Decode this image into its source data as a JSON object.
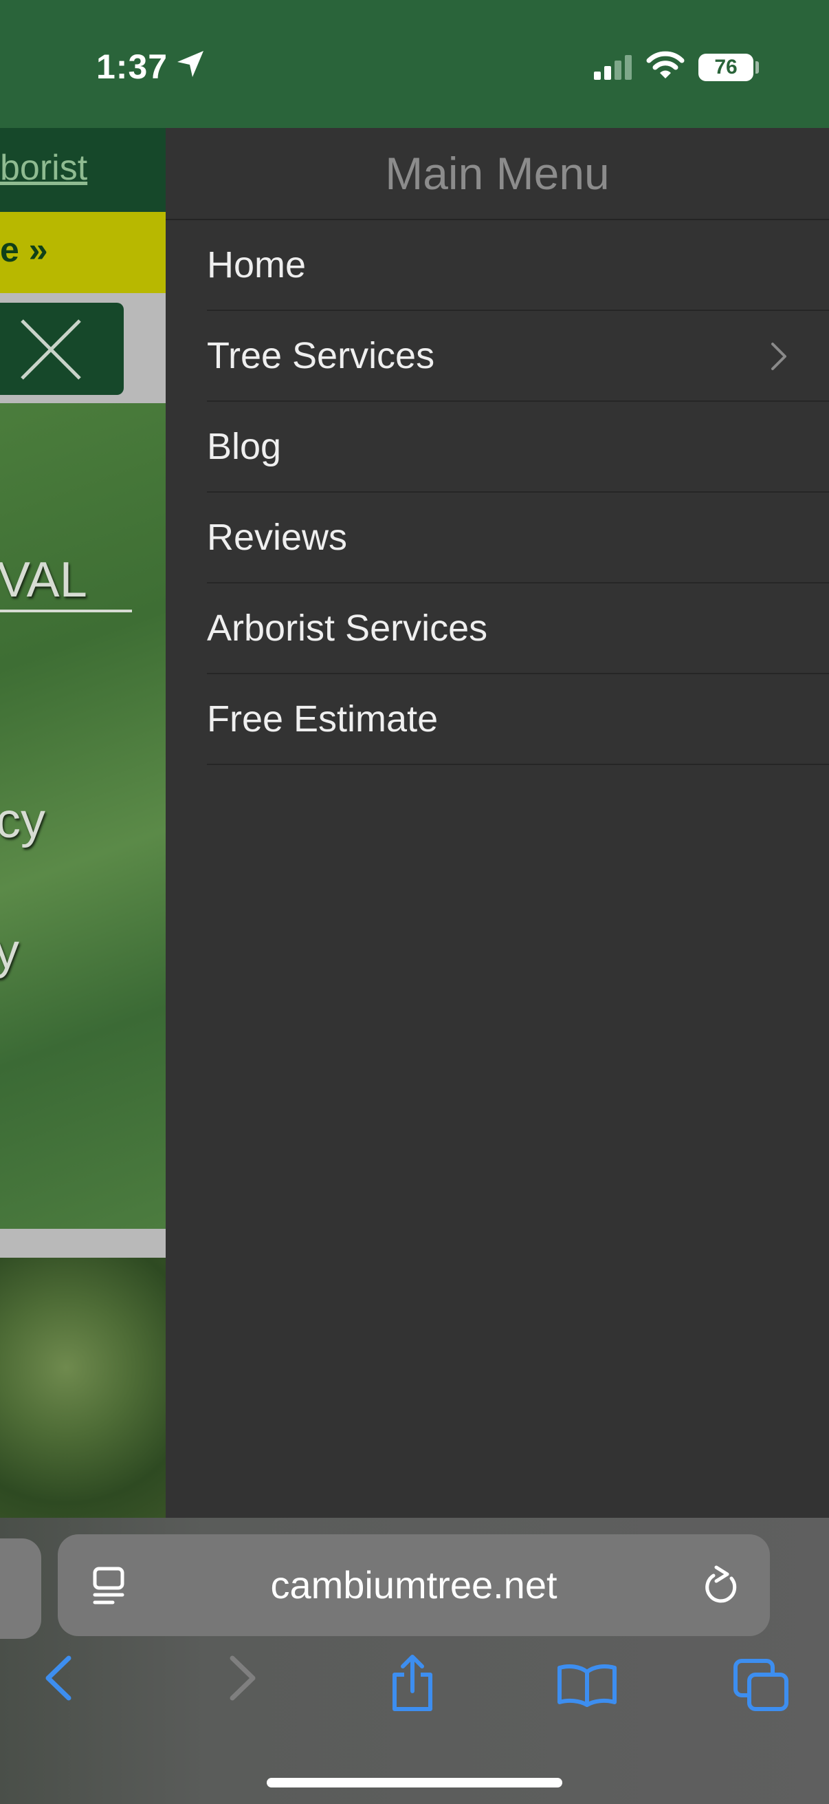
{
  "status_bar": {
    "time": "1:37",
    "battery": "76",
    "background_color": "#2a643a"
  },
  "background_page": {
    "header_link": "borist",
    "banner_text": "e »",
    "hero_line_1": "VAL",
    "hero_line_2": "cy",
    "hero_line_3": "y",
    "close_icon": "close-x-icon"
  },
  "menu": {
    "title": "Main Menu",
    "items": [
      {
        "label": "Home",
        "has_submenu": false
      },
      {
        "label": "Tree Services",
        "has_submenu": true
      },
      {
        "label": "Blog",
        "has_submenu": false
      },
      {
        "label": "Reviews",
        "has_submenu": false
      },
      {
        "label": "Arborist Services",
        "has_submenu": false
      },
      {
        "label": "Free Estimate",
        "has_submenu": false
      }
    ],
    "background_color": "#333333"
  },
  "browser": {
    "url": "cambiumtree.net",
    "toolbar_icons": [
      "back-icon",
      "forward-icon",
      "share-icon",
      "bookmarks-icon",
      "tabs-icon"
    ],
    "accent_color": "#3d8ef0"
  }
}
